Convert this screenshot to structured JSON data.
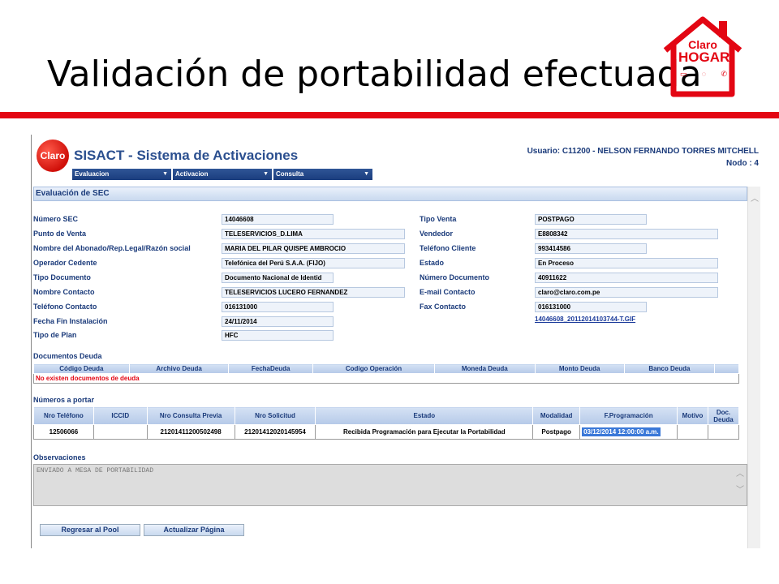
{
  "slide": {
    "title": "Validación de portabilidad efectuada",
    "brand_line1": "Claro",
    "brand_line2": "HOGAR",
    "accent_color": "#e30613"
  },
  "app": {
    "logo_text": "Claro",
    "title": "SISACT - Sistema de Activaciones",
    "user_line": "Usuario: C11200 - NELSON FERNANDO TORRES MITCHELL",
    "node_line": "Nodo : 4",
    "menu": [
      "Evaluacion",
      "Activacion",
      "Consulta"
    ]
  },
  "section_title": "Evaluación de SEC",
  "form_left": [
    {
      "label": "Número SEC",
      "value": "14046608"
    },
    {
      "label": "Punto de Venta",
      "value": "TELESERVICIOS_D.LIMA"
    },
    {
      "label": "Nombre del Abonado/Rep.Legal/Razón social",
      "value": "MARIA DEL PILAR QUISPE AMBROCIO"
    },
    {
      "label": "Operador Cedente",
      "value": "Telefónica del Perú S.A.A. (FIJO)"
    },
    {
      "label": "Tipo Documento",
      "value": "Documento Nacional de Identid"
    },
    {
      "label": "Nombre Contacto",
      "value": "TELESERVICIOS LUCERO FERNANDEZ"
    },
    {
      "label": "Teléfono Contacto",
      "value": "016131000"
    },
    {
      "label": "Fecha Fin Instalación",
      "value": "24/11/2014"
    },
    {
      "label": "Tipo de Plan",
      "value": "HFC"
    }
  ],
  "form_right": [
    {
      "label": "Tipo Venta",
      "value": "POSTPAGO"
    },
    {
      "label": "Vendedor",
      "value": "E8808342"
    },
    {
      "label": "Teléfono Cliente",
      "value": "993414586"
    },
    {
      "label": "Estado",
      "value": "En Proceso"
    },
    {
      "label": "Número Documento",
      "value": "40911622"
    },
    {
      "label": "E-mail Contacto",
      "value": "claro@claro.com.pe"
    },
    {
      "label": "Fax Contacto",
      "value": "016131000"
    },
    {
      "label": "",
      "value": "14046608_20112014103744-T.GIF"
    }
  ],
  "deuda": {
    "title": "Documentos Deuda",
    "headers": [
      "Código Deuda",
      "Archivo Deuda",
      "FechaDeuda",
      "Codigo Operación",
      "Moneda Deuda",
      "Monto Deuda",
      "Banco Deuda"
    ],
    "empty_message": "No existen documentos de deuda"
  },
  "numeros": {
    "title": "Números a portar",
    "headers": [
      "Nro Teléfono",
      "ICCID",
      "Nro Consulta Previa",
      "Nro Solicitud",
      "Estado",
      "Modalidad",
      "F.Programación",
      "Motivo",
      "Doc. Deuda"
    ],
    "rows": [
      [
        "12506066",
        "",
        "21201411200502498",
        "21201412020145954",
        "Recibida Programación para Ejecutar la Portabilidad",
        "Postpago",
        "03/12/2014 12:00:00 a.m.",
        "",
        ""
      ]
    ]
  },
  "observaciones": {
    "title": "Observaciones",
    "text": "ENVIADO A MESA DE PORTABILIDAD"
  },
  "buttons": {
    "back": "Regresar al Pool",
    "refresh": "Actualizar Página"
  }
}
